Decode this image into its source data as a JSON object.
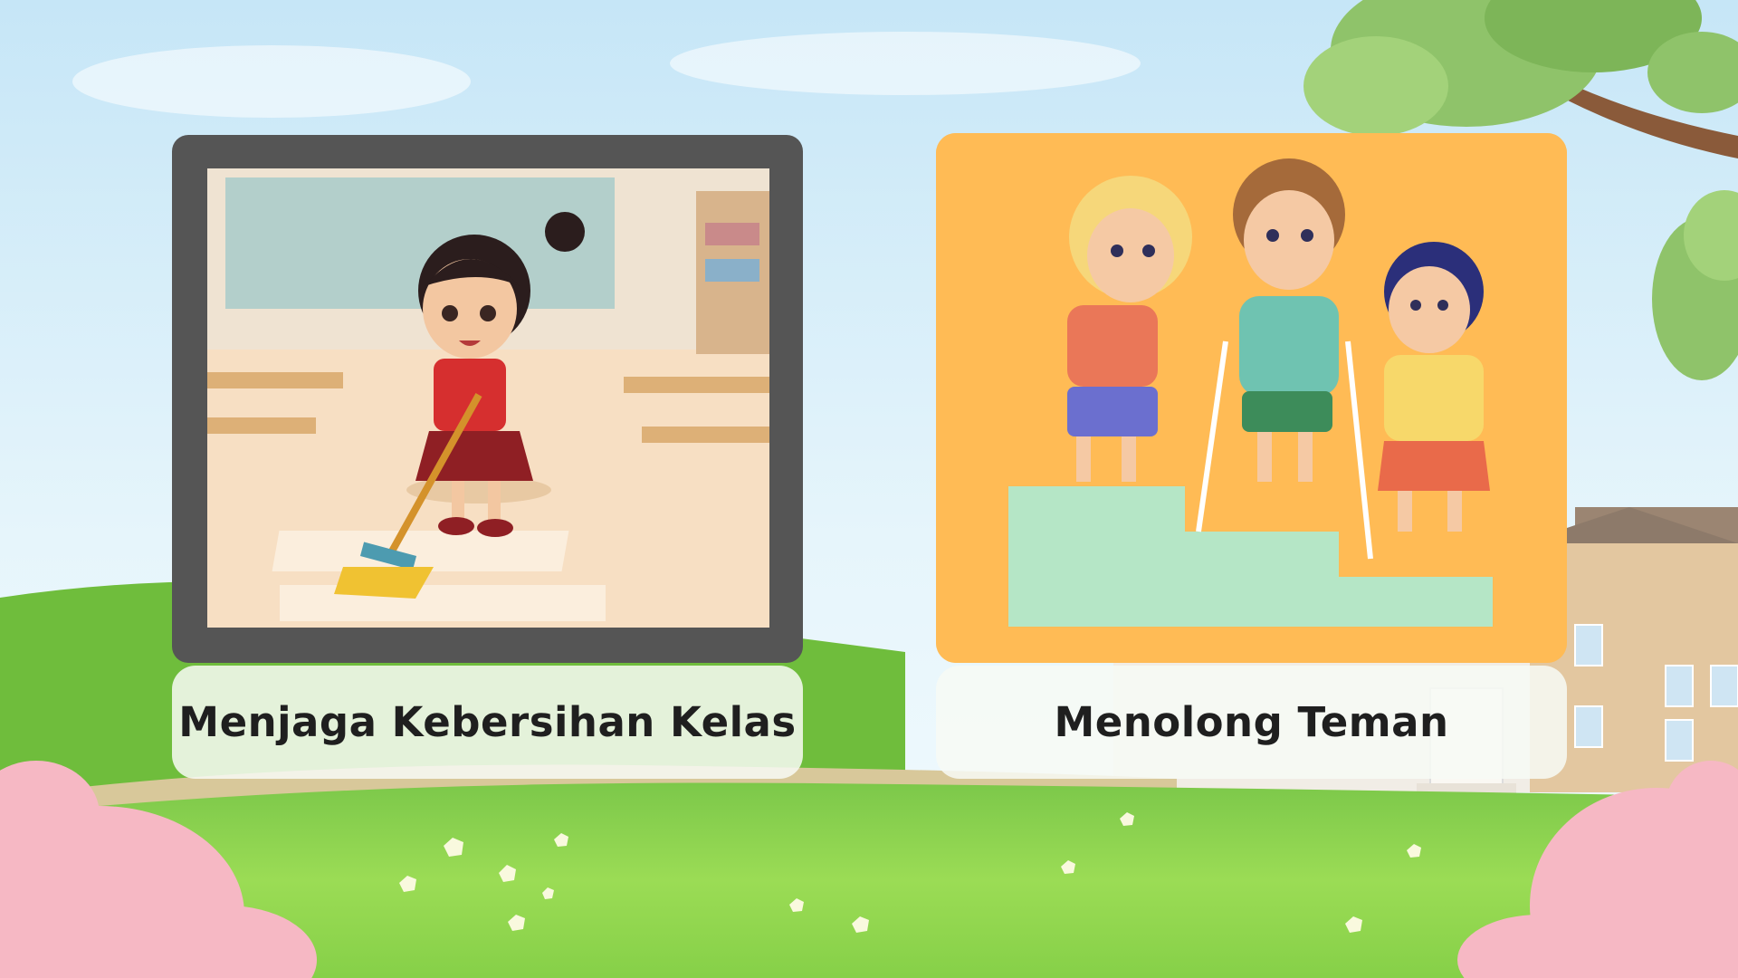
{
  "cards": [
    {
      "caption": "Menjaga Kebersihan Kelas",
      "image": "girl-sweeping-classroom"
    },
    {
      "caption": "Menolong Teman",
      "image": "children-helping-friend-on-stairs"
    }
  ],
  "colors": {
    "sky_top": "#b9dff5",
    "grass": "#86cf4a",
    "card_dark_frame": "#555555",
    "card_orange": "#ffbb55",
    "label_bg": "#f6f8f3",
    "caption_text": "#1f1f1f",
    "blossom": "#f6b8c4"
  }
}
